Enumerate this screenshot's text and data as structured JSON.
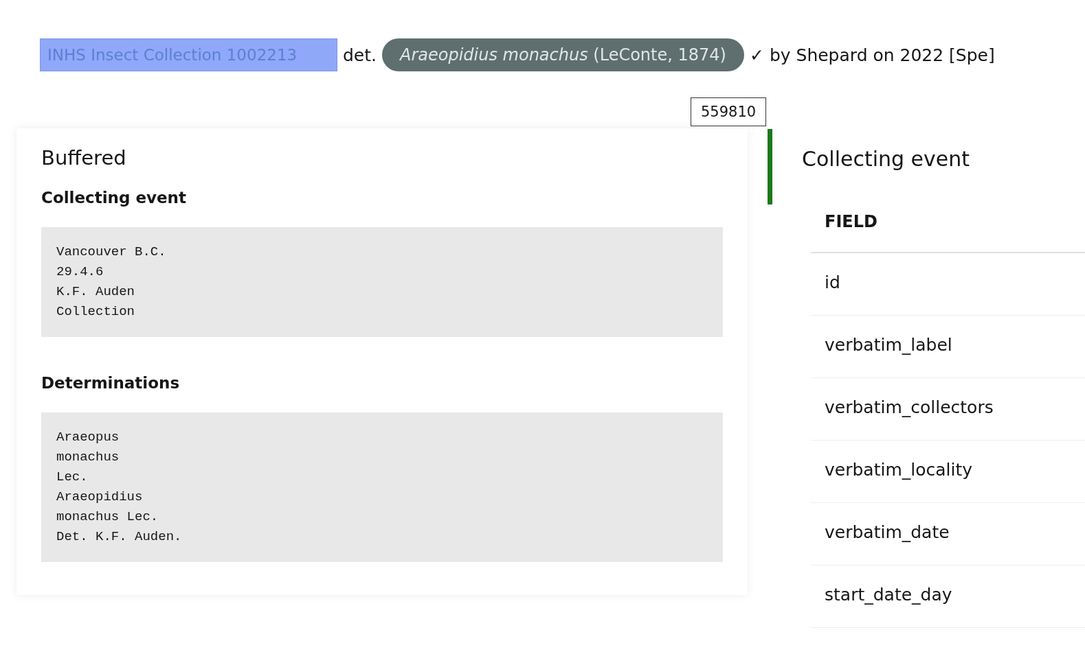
{
  "header": {
    "catalog_label": {
      "text": "INHS Insect Collection 1002213",
      "selected": true
    },
    "det": "det.",
    "taxon": {
      "name": "Araeopidius monachus",
      "author": "(LeConte, 1874)"
    },
    "verified": true,
    "check": "✓",
    "byline": "by Shepard on 2022 [Spe]"
  },
  "record_tag": "559810",
  "buffered": {
    "title": "Buffered",
    "sections": [
      {
        "heading": "Collecting event",
        "text": "Vancouver B.C.\n29.4.6\nK.F. Auden\nCollection"
      },
      {
        "heading": "Determinations",
        "text": "Araeopus\nmonachus\nLec.\nAraeopidius\nmonachus Lec.\nDet. K.F. Auden."
      }
    ]
  },
  "collecting_event": {
    "title": "Collecting event",
    "table": {
      "columns": [
        "FIELD"
      ],
      "rows": [
        "id",
        "verbatim_label",
        "verbatim_collectors",
        "verbatim_locality",
        "verbatim_date",
        "start_date_day"
      ]
    }
  }
}
